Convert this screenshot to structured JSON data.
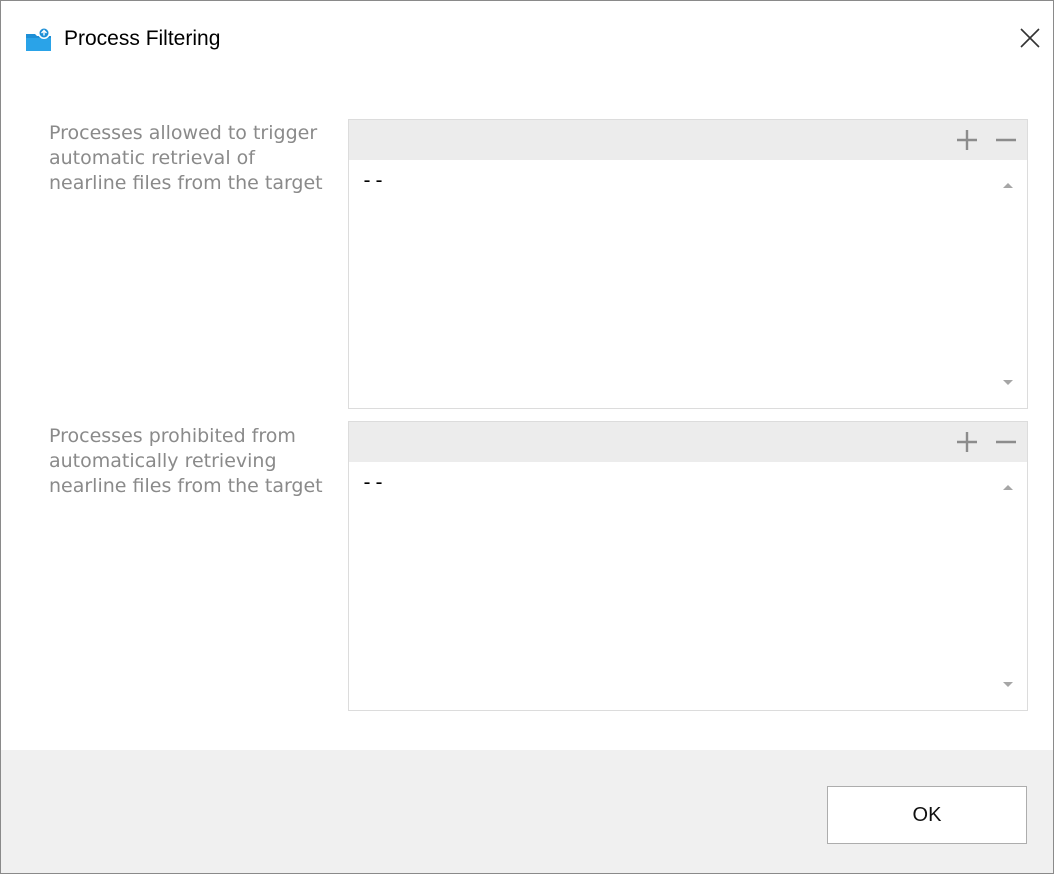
{
  "window": {
    "title": "Process Filtering",
    "app_icon": "cloud-folder-icon",
    "close_icon": "close-icon"
  },
  "allowed": {
    "label": "Processes allowed to trigger automatic retrieval of nearline files from the target",
    "items": [
      "--"
    ],
    "add_icon": "plus-icon",
    "remove_icon": "minus-icon"
  },
  "prohibited": {
    "label": "Processes prohibited from automatically retrieving nearline files from the target",
    "items": [
      "--"
    ],
    "add_icon": "plus-icon",
    "remove_icon": "minus-icon"
  },
  "footer": {
    "ok_label": "OK"
  },
  "colors": {
    "icon_blue": "#1e8fd6",
    "label_gray": "#8a8a8a",
    "toolbar_bg": "#ececec",
    "footer_bg": "#f0f0f0"
  }
}
